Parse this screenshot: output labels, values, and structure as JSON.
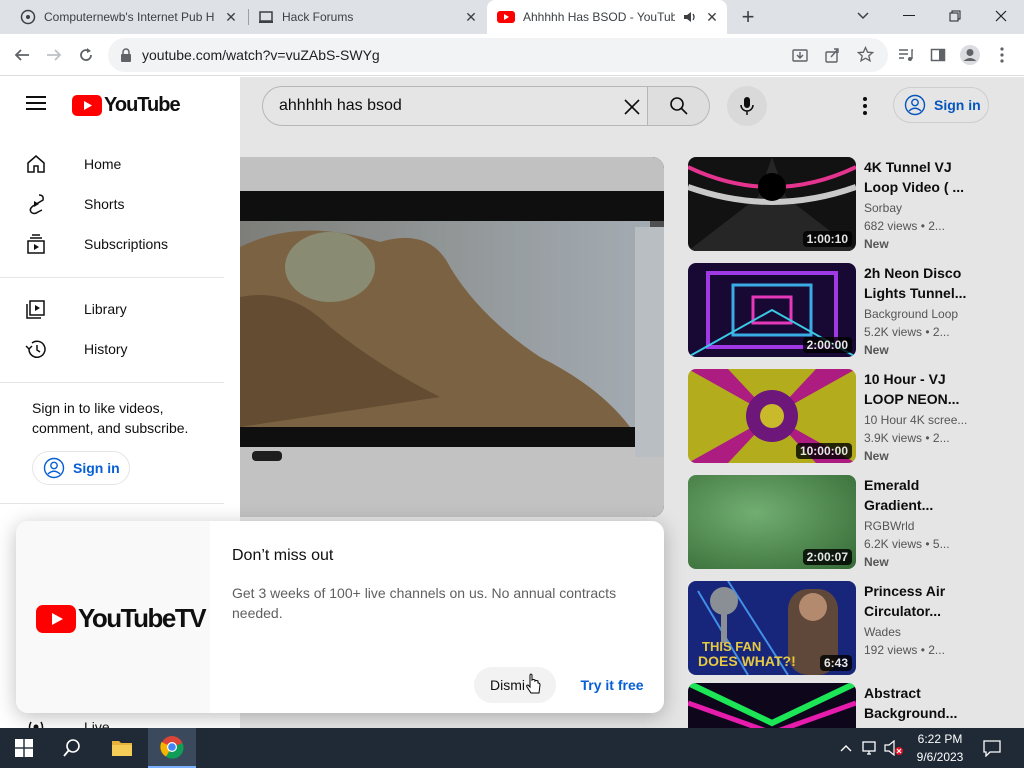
{
  "browser": {
    "tabs": [
      {
        "title": "Computernewb's Internet Pub H",
        "icon": "computernewb-favicon"
      },
      {
        "title": "Hack Forums",
        "icon": "hackforums-favicon"
      },
      {
        "title": "Ahhhhh Has BSOD - YouTub",
        "icon": "youtube-favicon",
        "active": true
      }
    ],
    "url": "youtube.com/watch?v=vuZAbS-SWYg"
  },
  "youtube": {
    "logo_text": "YouTube",
    "search_value": "ahhhhh has bsod",
    "signin_label": "Sign in",
    "sidebar": {
      "items": [
        {
          "label": "Home",
          "icon": "home-icon"
        },
        {
          "label": "Shorts",
          "icon": "shorts-icon"
        },
        {
          "label": "Subscriptions",
          "icon": "subscriptions-icon"
        },
        {
          "label": "Library",
          "icon": "library-icon"
        },
        {
          "label": "History",
          "icon": "history-icon"
        }
      ],
      "signin_prompt": "Sign in to like videos, comment, and subscribe.",
      "signin_button": "Sign in",
      "partial_item": "Live"
    },
    "recommended": [
      {
        "title": "4K Tunnel VJ Loop Video ( ...",
        "channel": "Sorbay",
        "views": "682 views • 2...",
        "badge": "New",
        "duration": "1:00:10"
      },
      {
        "title": "2h Neon Disco Lights Tunnel...",
        "channel": "Background Loop",
        "views": "5.2K views • 2...",
        "badge": "New",
        "duration": "2:00:00"
      },
      {
        "title": "10 Hour - VJ LOOP NEON...",
        "channel": "10 Hour 4K scree...",
        "views": "3.9K views • 2...",
        "badge": "New",
        "duration": "10:00:00"
      },
      {
        "title": "Emerald Gradient...",
        "channel": "RGBWrld",
        "views": "6.2K views • 5...",
        "badge": "New",
        "duration": "2:00:07"
      },
      {
        "title": "Princess Air Circulator...",
        "channel": "Wades",
        "views": "192 views • 2...",
        "badge": "",
        "duration": "6:43"
      },
      {
        "title": "Abstract Background...",
        "channel": "",
        "views": "",
        "badge": "",
        "duration": ""
      }
    ],
    "thumb5_text": [
      "THIS FAN",
      "DOES WHAT?!"
    ],
    "popup": {
      "logo_text": "YouTubeTV",
      "title": "Don’t miss out",
      "description": "Get 3 weeks of 100+ live channels on us. No annual contracts needed.",
      "dismiss_label": "Dismi",
      "try_label": "Try it free"
    }
  },
  "taskbar": {
    "time": "6:22 PM",
    "date": "9/6/2023"
  },
  "colors": {
    "youtube_red": "#ff0000",
    "link_blue": "#065fd4",
    "taskbar": "#1f2a36"
  }
}
